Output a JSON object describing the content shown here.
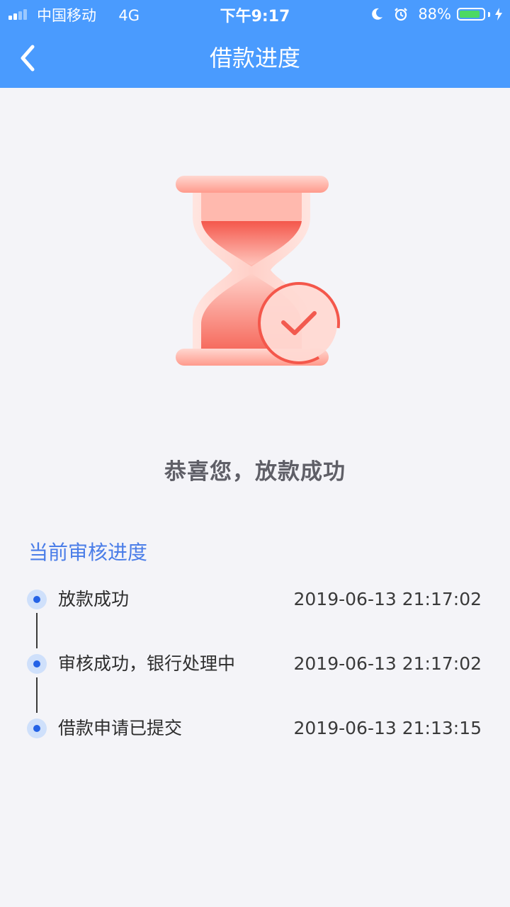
{
  "status_bar": {
    "carrier": "中国移动",
    "network": "4G",
    "time": "下午9:17",
    "battery_percent": "88%",
    "battery_level": 0.88,
    "icons": [
      "signal-icon",
      "moon-icon",
      "alarm-icon",
      "battery-icon",
      "charging-bolt-icon"
    ]
  },
  "nav": {
    "title": "借款进度",
    "back_icon": "chevron-left-icon"
  },
  "illustration": {
    "name": "hourglass-with-check-icon"
  },
  "result": {
    "headline": "恭喜您，放款成功"
  },
  "progress": {
    "section_title": "当前审核进度",
    "steps": [
      {
        "label": "放款成功",
        "time": "2019-06-13 21:17:02"
      },
      {
        "label": "审核成功，银行处理中",
        "time": "2019-06-13 21:17:02"
      },
      {
        "label": "借款申请已提交",
        "time": "2019-06-13 21:13:15"
      }
    ]
  },
  "colors": {
    "header_bg": "#4a9bfe",
    "page_bg": "#f4f4f8",
    "accent_blue": "#4a7de8",
    "dot_blue": "#2462e6",
    "hourglass_red": "#f4574b",
    "battery_green": "#4cd964"
  }
}
